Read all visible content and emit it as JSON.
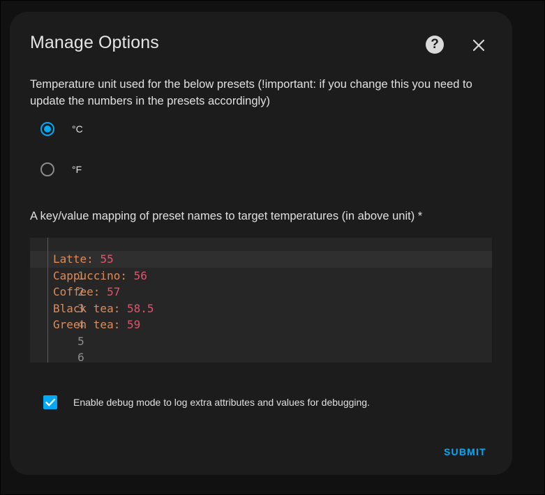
{
  "dialog": {
    "title": "Manage Options",
    "help_icon_glyph": "?",
    "help_icon": "help-circle-icon",
    "close_icon": "close-icon"
  },
  "temperature": {
    "description": "Temperature unit used for the below presets (!important: if you change this you need to update the numbers in the presets accordingly)",
    "options": [
      {
        "label": "°C",
        "selected": true
      },
      {
        "label": "°F",
        "selected": false
      }
    ]
  },
  "mapping": {
    "label": "A key/value mapping of preset names to target temperatures (in above unit) *",
    "lines": [
      {
        "number": "1",
        "key": "Latte",
        "value": "55"
      },
      {
        "number": "2",
        "key": "Cappuccino",
        "value": "56"
      },
      {
        "number": "3",
        "key": "Coffee",
        "value": "57"
      },
      {
        "number": "4",
        "key": "Black tea",
        "value": "58.5"
      },
      {
        "number": "5",
        "key": "Green tea",
        "value": "59"
      },
      {
        "number": "6",
        "key": "",
        "value": ""
      }
    ]
  },
  "debug": {
    "label": "Enable debug mode to log extra attributes and values for debugging.",
    "checked": true
  },
  "actions": {
    "submit_label": "SUBMIT"
  },
  "colors": {
    "accent": "#03a9f4",
    "dialog_background": "#1c1c1c",
    "editor_background": "#262626",
    "code_key": "#e08a58",
    "code_number": "#e0556b"
  }
}
